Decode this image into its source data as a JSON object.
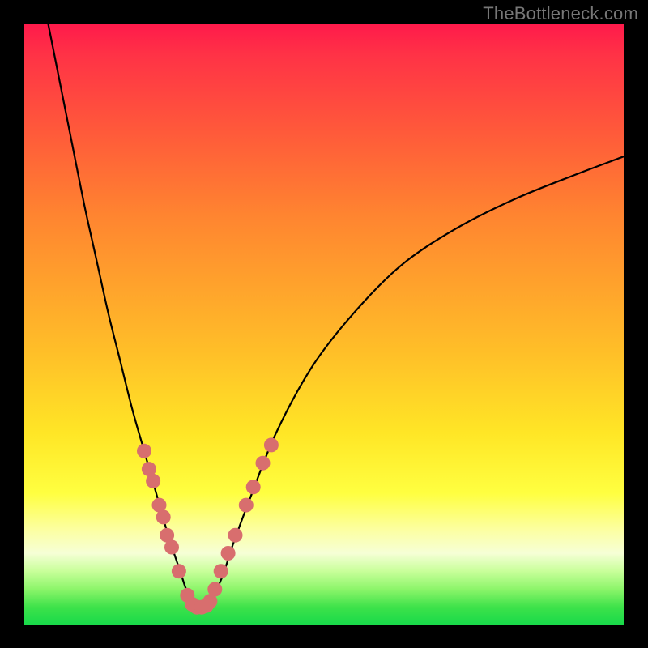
{
  "watermark": "TheBottleneck.com",
  "chart_data": {
    "type": "line",
    "title": "",
    "xlabel": "",
    "ylabel": "",
    "xlim": [
      0,
      100
    ],
    "ylim": [
      0,
      100
    ],
    "series": [
      {
        "name": "bottleneck-curve",
        "x": [
          4,
          6,
          8,
          10,
          12,
          14,
          16,
          18,
          20,
          22,
          24,
          26,
          27,
          28,
          29,
          30,
          31,
          33,
          35,
          38,
          42,
          48,
          55,
          63,
          72,
          82,
          92,
          100
        ],
        "y": [
          100,
          90,
          80,
          70,
          61,
          52,
          44,
          36,
          29,
          22,
          15,
          9,
          6,
          4,
          3,
          3,
          4,
          8,
          14,
          22,
          32,
          43,
          52,
          60,
          66,
          71,
          75,
          78
        ]
      }
    ],
    "markers": {
      "name": "highlight-dots",
      "color": "#d86e6e",
      "radius_px": 9,
      "points": [
        {
          "x": 20.0,
          "y": 29
        },
        {
          "x": 20.8,
          "y": 26
        },
        {
          "x": 21.5,
          "y": 24
        },
        {
          "x": 22.5,
          "y": 20
        },
        {
          "x": 23.2,
          "y": 18
        },
        {
          "x": 23.8,
          "y": 15
        },
        {
          "x": 24.6,
          "y": 13
        },
        {
          "x": 25.8,
          "y": 9
        },
        {
          "x": 27.2,
          "y": 5
        },
        {
          "x": 28.0,
          "y": 3.5
        },
        {
          "x": 28.8,
          "y": 3
        },
        {
          "x": 29.6,
          "y": 3
        },
        {
          "x": 30.4,
          "y": 3.3
        },
        {
          "x": 31.0,
          "y": 4
        },
        {
          "x": 31.8,
          "y": 6
        },
        {
          "x": 32.8,
          "y": 9
        },
        {
          "x": 34.0,
          "y": 12
        },
        {
          "x": 35.2,
          "y": 15
        },
        {
          "x": 37.0,
          "y": 20
        },
        {
          "x": 38.2,
          "y": 23
        },
        {
          "x": 39.8,
          "y": 27
        },
        {
          "x": 41.2,
          "y": 30
        }
      ]
    },
    "gradient_stops": [
      {
        "pos": 0,
        "color": "#ff1a4b"
      },
      {
        "pos": 18,
        "color": "#ff5a3a"
      },
      {
        "pos": 55,
        "color": "#ffc028"
      },
      {
        "pos": 78,
        "color": "#ffff40"
      },
      {
        "pos": 100,
        "color": "#17d94a"
      }
    ]
  }
}
